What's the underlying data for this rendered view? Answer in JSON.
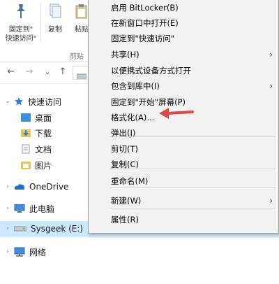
{
  "ribbon": {
    "pin_label_line1": "固定到\"",
    "pin_label_line2": "快速访问\"",
    "copy_label": "复制",
    "paste_label": "粘贴",
    "group_label": "剪贴"
  },
  "nav": {
    "back": "←",
    "forward": "→",
    "recent": "⌄",
    "up": "↑"
  },
  "sidebar": {
    "items": [
      {
        "label": "快速访问",
        "icon": "star-icon"
      },
      {
        "label": "桌面",
        "icon": "desktop-folder-icon"
      },
      {
        "label": "下载",
        "icon": "download-folder-icon"
      },
      {
        "label": "文档",
        "icon": "documents-folder-icon"
      },
      {
        "label": "图片",
        "icon": "pictures-folder-icon"
      },
      {
        "label": "OneDrive",
        "icon": "onedrive-cloud-icon"
      },
      {
        "label": "此电脑",
        "icon": "this-pc-icon"
      },
      {
        "label": "Sysgeek (E:)",
        "icon": "drive-icon"
      },
      {
        "label": "网络",
        "icon": "network-icon"
      }
    ]
  },
  "menu": {
    "items": [
      {
        "label": "启用 BitLocker(B)"
      },
      {
        "label": "在新窗口中打开(E)"
      },
      {
        "label": "固定到\"快速访问\""
      },
      {
        "label": "共享(H)",
        "submenu": "›"
      },
      {
        "label": "以便携式设备方式打开"
      },
      {
        "label": "包含到库中(I)",
        "submenu": "›"
      },
      {
        "label": "固定到\"开始\"屏幕(P)"
      },
      {
        "label": "格式化(A)..."
      },
      {
        "label": "弹出(J)"
      },
      {
        "label": "剪切(T)"
      },
      {
        "label": "复制(C)"
      },
      {
        "label": "重命名(M)"
      },
      {
        "label": "新建(W)",
        "submenu": "›"
      },
      {
        "label": "属性(R)"
      }
    ]
  },
  "colors": {
    "arrow": "#e04848",
    "selection": "#cce8ff",
    "menu_bg": "#f2f2f2"
  }
}
